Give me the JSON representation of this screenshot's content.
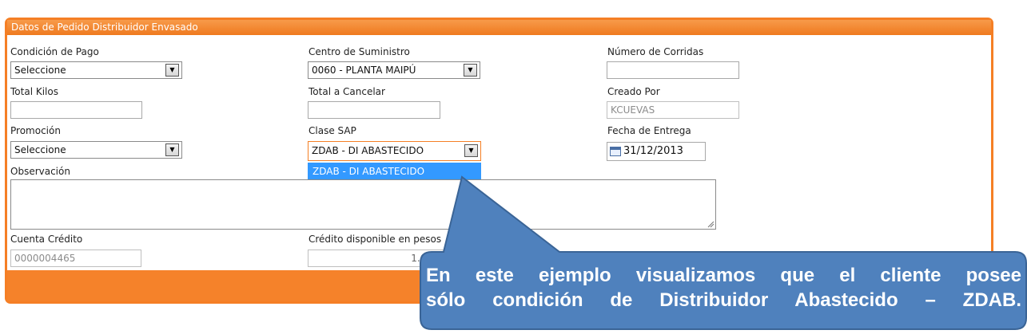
{
  "panel": {
    "title": "Datos de Pedido Distribuidor Envasado"
  },
  "fields": {
    "condicion_pago": {
      "label": "Condición de Pago",
      "value": "Seleccione"
    },
    "centro_suministro": {
      "label": "Centro de Suministro",
      "value": "0060 - PLANTA MAIPÚ"
    },
    "numero_corridas": {
      "label": "Número de Corridas",
      "value": ""
    },
    "total_kilos": {
      "label": "Total Kilos",
      "value": ""
    },
    "total_cancelar": {
      "label": "Total a Cancelar",
      "value": ""
    },
    "creado_por": {
      "label": "Creado Por",
      "value": "KCUEVAS"
    },
    "promocion": {
      "label": "Promoción",
      "value": "Seleccione"
    },
    "clase_sap": {
      "label": "Clase SAP",
      "value": "ZDAB - DI ABASTECIDO",
      "options": [
        "ZDAB - DI ABASTECIDO"
      ]
    },
    "fecha_entrega": {
      "label": "Fecha de Entrega",
      "value": "31/12/2013"
    },
    "observacion": {
      "label": "Observación",
      "value": ""
    },
    "cuenta_credito": {
      "label": "Cuenta Crédito",
      "value": "0000004465"
    },
    "credito_disponible": {
      "label": "Crédito disponible en pesos",
      "value": "1.682.0"
    }
  },
  "callout": {
    "line1": "En este ejemplo visualizamos que el cliente posee",
    "line2": "sólo condición de Distribuidor Abastecido – ZDAB.",
    "fill_color": "#4f81bd",
    "border_color": "#3a6496"
  },
  "colors": {
    "panel_orange": "#f57f25",
    "selection_blue": "#3399ff"
  }
}
